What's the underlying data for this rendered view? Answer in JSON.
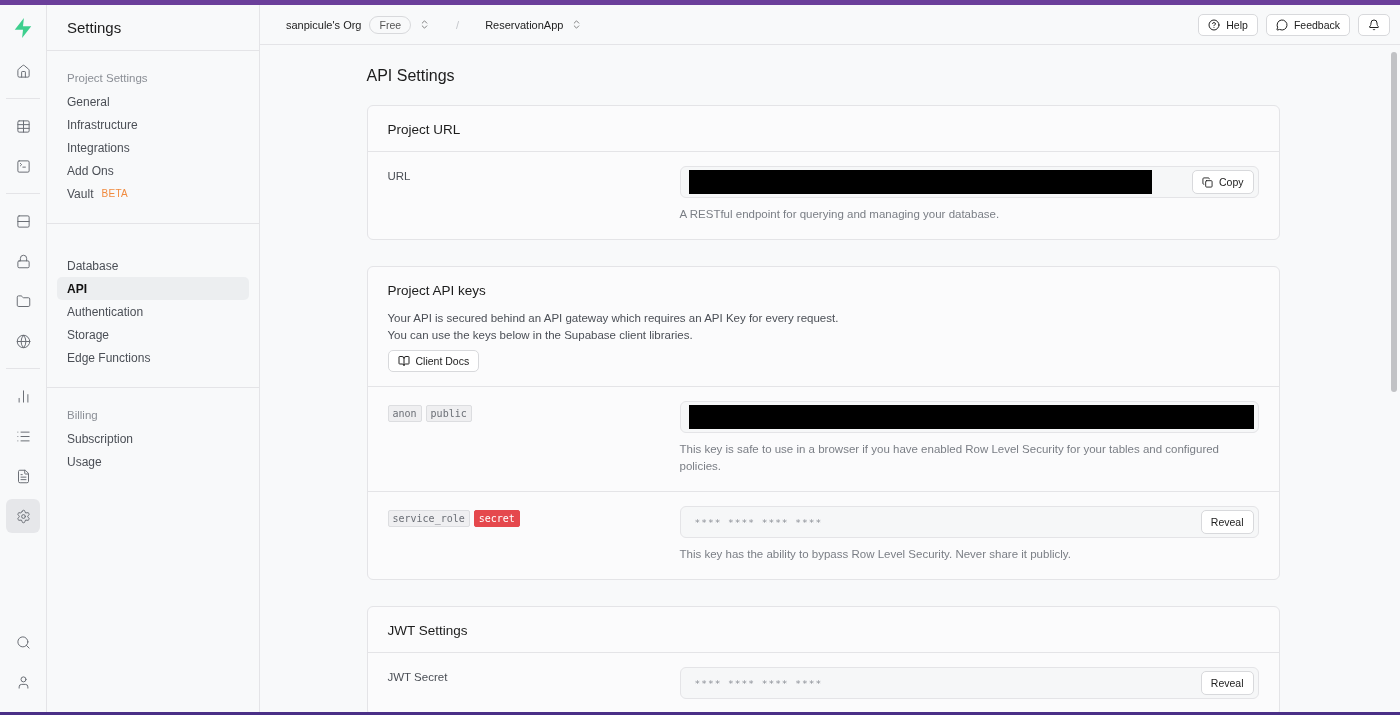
{
  "rail": [
    {
      "selected": false
    },
    {
      "selected": false
    },
    {
      "selected": false
    },
    {
      "selected": false
    },
    {
      "selected": false
    },
    {
      "selected": false
    },
    {
      "selected": false
    },
    {
      "selected": false
    },
    {
      "selected": false
    },
    {
      "selected": false
    },
    {
      "selected": true
    },
    {
      "selected": false
    },
    {
      "selected": false
    }
  ],
  "sidebar": {
    "title": "Settings",
    "sections": [
      {
        "heading": "Project Settings",
        "items": [
          {
            "label": "General",
            "selected": false
          },
          {
            "label": "Infrastructure",
            "selected": false
          },
          {
            "label": "Integrations",
            "selected": false
          },
          {
            "label": "Add Ons",
            "selected": false
          },
          {
            "label": "Vault",
            "badge": "BETA",
            "selected": false
          }
        ]
      },
      {
        "items": [
          {
            "label": "Database",
            "selected": false
          },
          {
            "label": "API",
            "selected": true
          },
          {
            "label": "Authentication",
            "selected": false
          },
          {
            "label": "Storage",
            "selected": false
          },
          {
            "label": "Edge Functions",
            "selected": false
          }
        ]
      },
      {
        "heading": "Billing",
        "items": [
          {
            "label": "Subscription",
            "selected": false
          },
          {
            "label": "Usage",
            "selected": false
          }
        ]
      }
    ]
  },
  "header": {
    "org": "sanpicule's Org",
    "plan": "Free",
    "separator": "/",
    "project": "ReservationApp",
    "help": "Help",
    "feedback": "Feedback"
  },
  "page_title": "API Settings",
  "cards": [
    {
      "title": "Project URL",
      "rows": [
        {
          "kind": "redacted",
          "label": "URL",
          "button": "Copy",
          "hint": "A RESTful endpoint for querying and managing your database."
        }
      ]
    },
    {
      "title": "Project API keys",
      "description": [
        "Your API is secured behind an API gateway which requires an API Key for every request.",
        "You can use the keys below in the Supabase client libraries."
      ],
      "button": "Client Docs",
      "rows": [
        {
          "kind": "redacted",
          "tags": [
            {
              "text": "anon",
              "kind": "plain"
            },
            {
              "text": "public",
              "kind": "plain"
            }
          ],
          "hint": "This key is safe to use in a browser if you have enabled Row Level Security for your tables and configured policies."
        },
        {
          "kind": "masked",
          "tags": [
            {
              "text": "service_role",
              "kind": "plain"
            },
            {
              "text": "secret",
              "kind": "danger"
            }
          ],
          "value": "**** **** **** ****",
          "button": "Reveal",
          "hint": "This key has the ability to bypass Row Level Security. Never share it publicly."
        }
      ]
    },
    {
      "title": "JWT Settings",
      "rows": [
        {
          "kind": "masked",
          "label": "JWT Secret",
          "value": "**** **** **** ****",
          "button": "Reveal"
        }
      ]
    }
  ]
}
